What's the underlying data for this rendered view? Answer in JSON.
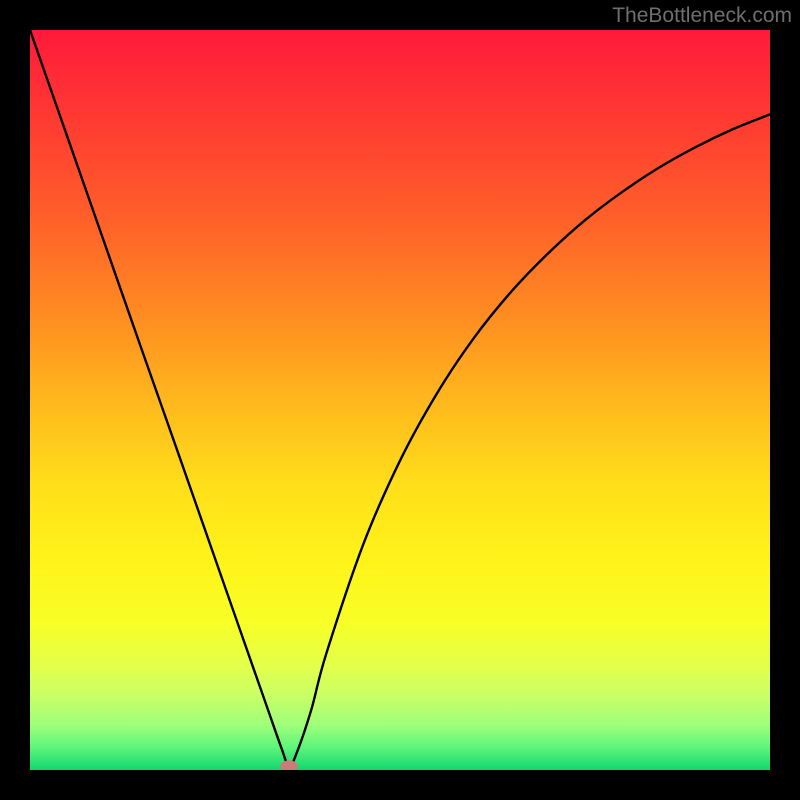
{
  "watermark": "TheBottleneck.com",
  "chart_data": {
    "type": "line",
    "title": "",
    "xlabel": "",
    "ylabel": "",
    "xlim": [
      0,
      100
    ],
    "ylim": [
      0,
      100
    ],
    "x": [
      0,
      5,
      10,
      15,
      20,
      25,
      30,
      32,
      34,
      35,
      36,
      38,
      40,
      45,
      50,
      55,
      60,
      65,
      70,
      75,
      80,
      85,
      90,
      95,
      100
    ],
    "y": [
      100,
      85.7,
      71.4,
      57.1,
      42.9,
      28.6,
      14.3,
      8.6,
      2.9,
      0.5,
      2.2,
      8.1,
      15.6,
      30.4,
      41.8,
      50.9,
      58.4,
      64.6,
      69.8,
      74.3,
      78.1,
      81.4,
      84.2,
      86.6,
      88.6
    ],
    "marker": {
      "x": 35,
      "y": 0.5,
      "rx": 1.2,
      "ry": 0.8,
      "color": "#cc7a7a"
    },
    "gradient_stops": [
      {
        "pos": 0.0,
        "color": "#ff1a3b"
      },
      {
        "pos": 0.12,
        "color": "#ff3a32"
      },
      {
        "pos": 0.25,
        "color": "#ff5e2a"
      },
      {
        "pos": 0.38,
        "color": "#ff8a22"
      },
      {
        "pos": 0.5,
        "color": "#ffb71d"
      },
      {
        "pos": 0.62,
        "color": "#ffe01a"
      },
      {
        "pos": 0.72,
        "color": "#fff41a"
      },
      {
        "pos": 0.8,
        "color": "#f7ff26"
      },
      {
        "pos": 0.86,
        "color": "#e3ff4a"
      },
      {
        "pos": 0.9,
        "color": "#c8ff66"
      },
      {
        "pos": 0.94,
        "color": "#9dff7a"
      },
      {
        "pos": 0.97,
        "color": "#5cf57b"
      },
      {
        "pos": 1.0,
        "color": "#12d66f"
      }
    ],
    "curve_color": "#000000",
    "curve_width": 2.4
  }
}
